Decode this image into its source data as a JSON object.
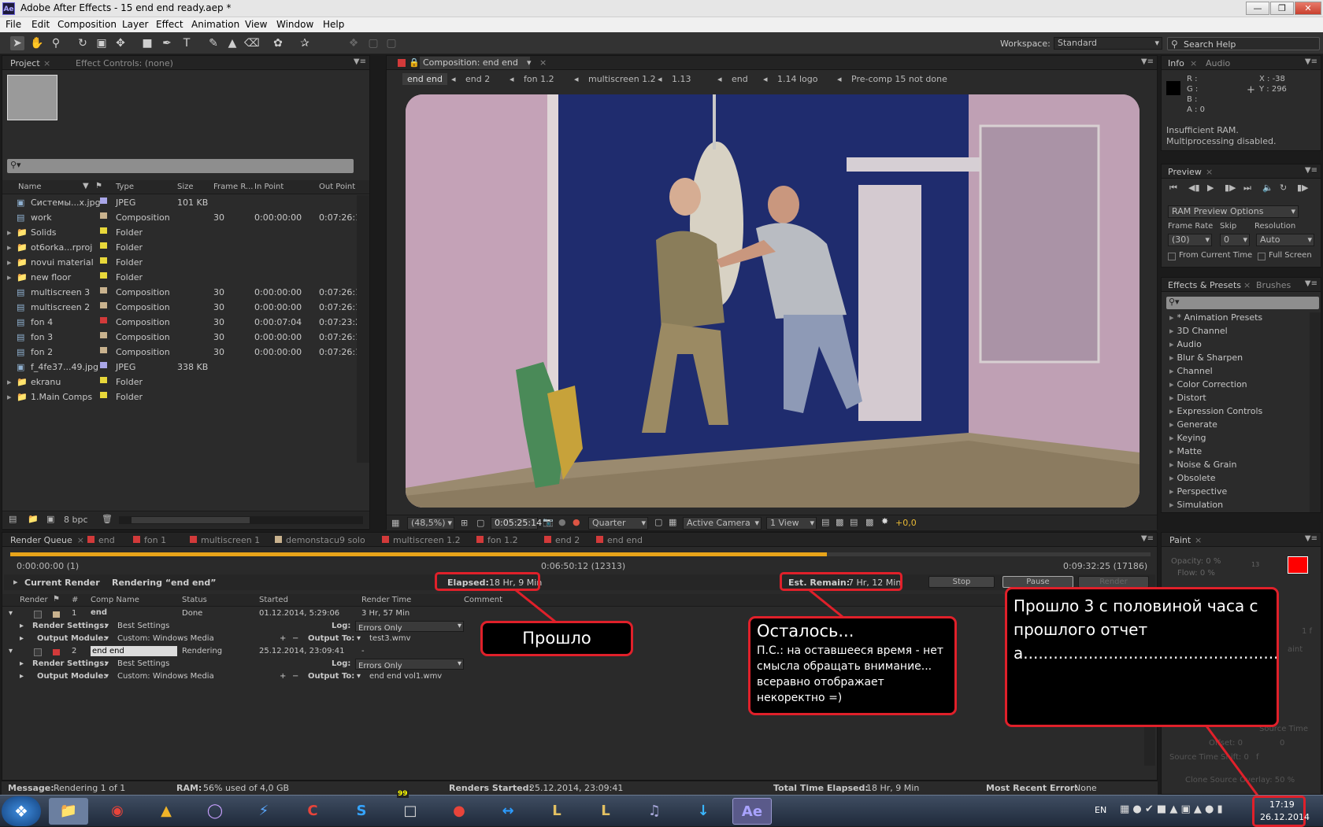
{
  "window": {
    "title": "Adobe After Effects - 15 end end ready.aep *",
    "app_icon": "Ae"
  },
  "menu": [
    "File",
    "Edit",
    "Composition",
    "Layer",
    "Effect",
    "Animation",
    "View",
    "Window",
    "Help"
  ],
  "toolbar": {
    "workspace_label": "Workspace:",
    "workspace_value": "Standard",
    "search_placeholder": "Search Help"
  },
  "project": {
    "tabs": [
      "Project",
      "Effect Controls: (none)"
    ],
    "columns": [
      "Name",
      "Type",
      "Size",
      "Frame R...",
      "In Point",
      "Out Point"
    ],
    "items": [
      {
        "name": "Системы...x.jpg",
        "color": "#a9a6e8",
        "type": "JPEG",
        "size": "101 KB",
        "fr": "",
        "in": "",
        "out": "",
        "icon": "image-icon"
      },
      {
        "name": "work",
        "color": "#c9b28e",
        "type": "Composition",
        "size": "",
        "fr": "30",
        "in": "0:00:00:00",
        "out": "0:07:26:19",
        "icon": "composition-icon"
      },
      {
        "name": "Solids",
        "color": "#e8d83a",
        "type": "Folder",
        "size": "",
        "fr": "",
        "in": "",
        "out": "",
        "icon": "folder-icon"
      },
      {
        "name": "ot6orka...rproj",
        "color": "#e8d83a",
        "type": "Folder",
        "size": "",
        "fr": "",
        "in": "",
        "out": "",
        "icon": "folder-icon"
      },
      {
        "name": "novui material",
        "color": "#e8d83a",
        "type": "Folder",
        "size": "",
        "fr": "",
        "in": "",
        "out": "",
        "icon": "folder-icon"
      },
      {
        "name": "new floor",
        "color": "#e8d83a",
        "type": "Folder",
        "size": "",
        "fr": "",
        "in": "",
        "out": "",
        "icon": "folder-icon"
      },
      {
        "name": "multiscreen 3",
        "color": "#c9b28e",
        "type": "Composition",
        "size": "",
        "fr": "30",
        "in": "0:00:00:00",
        "out": "0:07:26:19",
        "icon": "composition-icon"
      },
      {
        "name": "multiscreen 2",
        "color": "#c9b28e",
        "type": "Composition",
        "size": "",
        "fr": "30",
        "in": "0:00:00:00",
        "out": "0:07:26:19",
        "icon": "composition-icon"
      },
      {
        "name": "fon 4",
        "color": "#d23a3a",
        "type": "Composition",
        "size": "",
        "fr": "30",
        "in": "0:00:07:04",
        "out": "0:07:23:22",
        "icon": "composition-icon"
      },
      {
        "name": "fon 3",
        "color": "#c9b28e",
        "type": "Composition",
        "size": "",
        "fr": "30",
        "in": "0:00:00:00",
        "out": "0:07:26:19",
        "icon": "composition-icon"
      },
      {
        "name": "fon 2",
        "color": "#c9b28e",
        "type": "Composition",
        "size": "",
        "fr": "30",
        "in": "0:00:00:00",
        "out": "0:07:26:19",
        "icon": "composition-icon"
      },
      {
        "name": "f_4fe37...49.jpg",
        "color": "#a9a6e8",
        "type": "JPEG",
        "size": "338 KB",
        "fr": "",
        "in": "",
        "out": "",
        "icon": "image-icon"
      },
      {
        "name": "ekranu",
        "color": "#e8d83a",
        "type": "Folder",
        "size": "",
        "fr": "",
        "in": "",
        "out": "",
        "icon": "folder-icon"
      },
      {
        "name": "1.Main Comps",
        "color": "#e8d83a",
        "type": "Folder",
        "size": "",
        "fr": "",
        "in": "",
        "out": "",
        "icon": "folder-icon"
      }
    ],
    "bpc": "8 bpc"
  },
  "composition": {
    "tab": "Composition: end end",
    "breadcrumbs": [
      "end end",
      "end 2",
      "fon 1.2",
      "multiscreen 1.2",
      "1.13",
      "end",
      "1.14 logo",
      "Pre-comp 15 not done"
    ],
    "zoom": "(48,5%)",
    "timecode": "0:05:25:14",
    "resolution": "Quarter",
    "camera": "Active Camera",
    "views": "1 View",
    "exposure": "+0,0"
  },
  "info": {
    "tabs": [
      "Info",
      "Audio"
    ],
    "r": "R :",
    "g": "G :",
    "b": "B :",
    "a": "A : 0",
    "x": "X : -38",
    "y": "Y : 296",
    "message1": "Insufficient RAM.",
    "message2": "Multiprocessing disabled."
  },
  "preview": {
    "tab": "Preview",
    "ram_options": "RAM Preview Options",
    "frame_rate_label": "Frame Rate",
    "skip_label": "Skip",
    "resolution_label": "Resolution",
    "frame_rate": "(30)",
    "skip": "0",
    "resolution": "Auto",
    "from_current": "From Current Time",
    "full_screen": "Full Screen"
  },
  "effects": {
    "tabs": [
      "Effects & Presets",
      "Brushes"
    ],
    "items": [
      "* Animation Presets",
      "3D Channel",
      "Audio",
      "Blur & Sharpen",
      "Channel",
      "Color Correction",
      "Distort",
      "Expression Controls",
      "Generate",
      "Keying",
      "Matte",
      "Noise & Grain",
      "Obsolete",
      "Perspective",
      "Simulation"
    ]
  },
  "paint": {
    "tab": "Paint",
    "opacity": "Opacity: 0 %",
    "flow": "Flow: 0 %",
    "brush_size": "13",
    "source_time": "Source Time",
    "offset": "Offset: 0",
    "offset_val": "0",
    "shift": "Source Time Shift: 0",
    "shift_unit": "f",
    "overlay": "Clone Source Overlay: 50 %",
    "paint_label": "aint",
    "one_f": "1 f"
  },
  "render_queue": {
    "tabs": [
      "Render Queue",
      "end",
      "fon 1",
      "multiscreen 1",
      "demonstacu9 solo",
      "multiscreen 1.2",
      "fon 1.2",
      "end 2",
      "end end"
    ],
    "start_time": "0:00:00:00 (1)",
    "current_time": "0:06:50:12 (12313)",
    "end_time": "0:09:32:25 (17186)",
    "progress": 0.716,
    "current_render_label": "Current Render",
    "rendering_text": "Rendering “end end”",
    "elapsed_label": "Elapsed:",
    "elapsed_value": "18 Hr, 9 Min",
    "remain_label": "Est. Remain:",
    "remain_value": "7 Hr, 12 Min",
    "stop": "Stop",
    "pause": "Pause",
    "render": "Render",
    "columns": [
      "Render",
      "#",
      "Comp Name",
      "Status",
      "Started",
      "Render Time",
      "Comment"
    ],
    "items": [
      {
        "num": "1",
        "comp": "end",
        "status": "Done",
        "started": "01.12.2014, 5:29:06",
        "time": "3 Hr, 57 Min",
        "settings": "Best Settings",
        "log": "Errors Only",
        "module": "Custom: Windows Media",
        "output": "test3.wmv",
        "color": "#c9b28e"
      },
      {
        "num": "2",
        "comp": "end end",
        "status": "Rendering",
        "started": "25.12.2014, 23:09:41",
        "time": "-",
        "settings": "Best Settings",
        "log": "Errors Only",
        "module": "Custom: Windows Media",
        "output": "end end vol1.wmv",
        "color": "#d23a3a"
      }
    ],
    "render_settings_label": "Render Settings:",
    "output_module_label": "Output Module:",
    "log_label": "Log:",
    "output_to_label": "Output To:"
  },
  "status": {
    "message_label": "Message:",
    "message": "Rendering 1 of 1",
    "ram_label": "RAM:",
    "ram": "56% used of 4,0 GB",
    "started_label": "Renders Started:",
    "started": "25.12.2014, 23:09:41",
    "elapsed_label": "Total Time Elapsed:",
    "elapsed": "18 Hr, 9 Min",
    "error_label": "Most Recent Error:",
    "error": "None"
  },
  "annotations": {
    "elapsed": "Прошло",
    "remaining_title": "Осталось...",
    "remaining_body": "П.С.: на оставшееся время - нет смысла обращать внимание... всеравно отображает некоректно =)",
    "clock_note": "Прошло 3 с половиной часа с прошлого отчета........................................................................................................................................................................................"
  },
  "taskbar": {
    "lang": "EN",
    "time": "17:19",
    "date": "26.12.2014",
    "badge": "99"
  }
}
